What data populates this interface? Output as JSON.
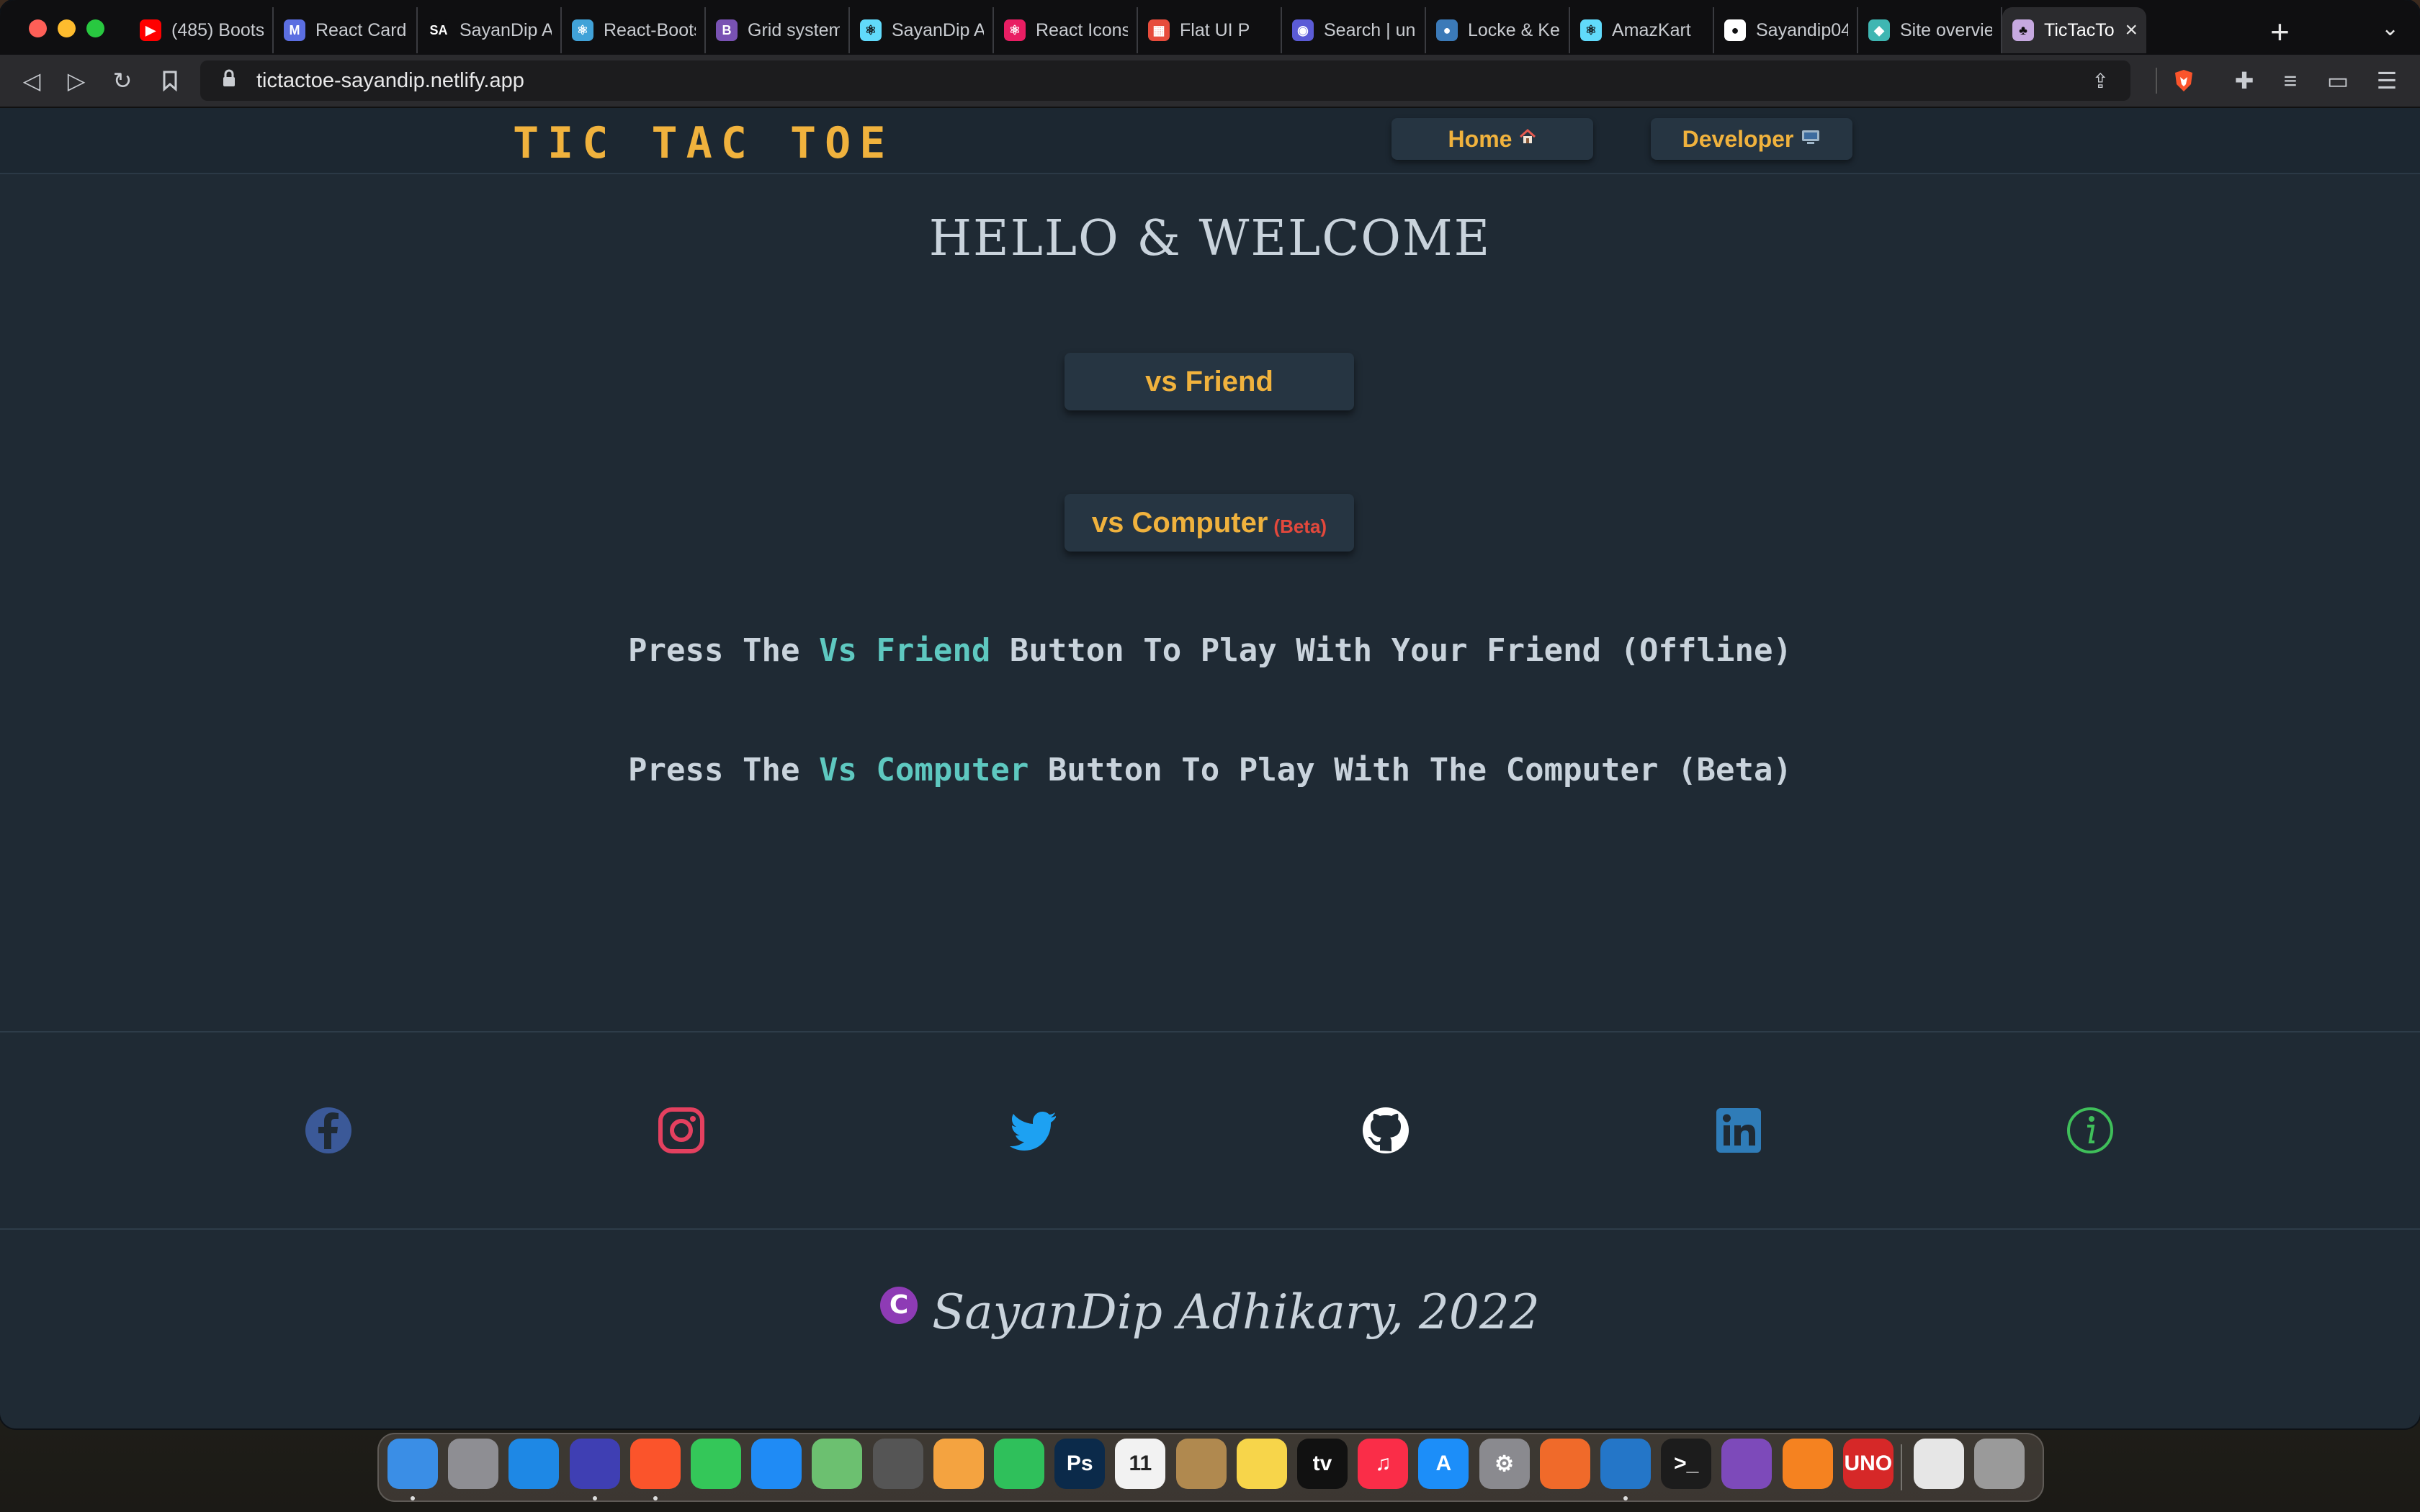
{
  "browser": {
    "tabs": [
      {
        "label": "(485) Boots",
        "favicon": "youtube-icon",
        "color": "#ff0000",
        "glyph": "▶"
      },
      {
        "label": "React Card",
        "favicon": "react-bootstrap-icon",
        "color": "#5b6ee1",
        "glyph": "M"
      },
      {
        "label": "SayanDip Ac",
        "favicon": "sa-icon",
        "color": "#0f0f11",
        "glyph": "SA"
      },
      {
        "label": "React-Boots",
        "favicon": "react-bootstrap-icon",
        "color": "#41a2d8",
        "glyph": "⚛"
      },
      {
        "label": "Grid system",
        "favicon": "bootstrap-icon",
        "color": "#7952b3",
        "glyph": "B"
      },
      {
        "label": "SayanDip Ac",
        "favicon": "react-icon",
        "color": "#61dafb",
        "glyph": "⚛"
      },
      {
        "label": "React Icons",
        "favicon": "react-icon",
        "color": "#e91e63",
        "glyph": "⚛"
      },
      {
        "label": "Flat UI P",
        "favicon": "flat-ui-icon",
        "color": "#e74c3c",
        "glyph": "▦"
      },
      {
        "label": "Search | unD",
        "favicon": "search-icon",
        "color": "#5b5bd6",
        "glyph": "◉"
      },
      {
        "label": "Locke & Key",
        "favicon": "netflix-icon",
        "color": "#3b7ab8",
        "glyph": "●"
      },
      {
        "label": "AmazKart",
        "favicon": "react-icon",
        "color": "#61dafb",
        "glyph": "⚛"
      },
      {
        "label": "Sayandip04",
        "favicon": "github-icon",
        "color": "#ffffff",
        "glyph": "●"
      },
      {
        "label": "Site overvie",
        "favicon": "netlify-icon",
        "color": "#3fb6b2",
        "glyph": "◆"
      },
      {
        "label": "TicTacTo",
        "favicon": "tictactoe-icon",
        "color": "#c6a9e0",
        "glyph": "♣",
        "active": true
      }
    ],
    "url": "tictactoe-sayandip.netlify.app"
  },
  "nav": {
    "brand": "TIC TAC TOE",
    "home_label": "Home",
    "developer_label": "Developer"
  },
  "main": {
    "welcome": "HELLO & WELCOME",
    "vs_friend_label": "vs Friend",
    "vs_computer_label": "vs Computer",
    "beta_label": "(Beta)",
    "instr1": {
      "pre": "Press The ",
      "hl": "Vs Friend",
      "post": " Button To Play With Your Friend (Offline)"
    },
    "instr2": {
      "pre": "Press The ",
      "hl": "Vs Computer",
      "post": " Button To Play With The Computer (Beta)"
    }
  },
  "social": [
    {
      "name": "facebook-icon",
      "color": "#3b5998"
    },
    {
      "name": "instagram-icon",
      "color": "#e1306c"
    },
    {
      "name": "twitter-icon",
      "color": "#1da1f2"
    },
    {
      "name": "github-icon",
      "color": "#ffffff"
    },
    {
      "name": "linkedin-icon",
      "color": "#2f7cb8"
    },
    {
      "name": "info-icon",
      "color": "#3fbf5a"
    }
  ],
  "footer": {
    "copyright_symbol": "C",
    "text": "SayanDip Adhikary, 2022"
  },
  "dock": [
    {
      "name": "finder-icon",
      "color": "#3a8ee6"
    },
    {
      "name": "launchpad-icon",
      "color": "#8e8e93"
    },
    {
      "name": "safari-icon",
      "color": "#1e88e5"
    },
    {
      "name": "firefox-icon",
      "color": "#3f3fb3"
    },
    {
      "name": "brave-icon",
      "color": "#fb542b"
    },
    {
      "name": "messages-icon",
      "color": "#34c759"
    },
    {
      "name": "mail-icon",
      "color": "#1f8bf5"
    },
    {
      "name": "maps-icon",
      "color": "#6cc070"
    },
    {
      "name": "calculator-icon",
      "color": "#555555"
    },
    {
      "name": "photos-icon",
      "color": "#f4a340"
    },
    {
      "name": "facetime-icon",
      "color": "#2fc05b"
    },
    {
      "name": "photoshop-icon",
      "color": "#0b2a4a",
      "glyph": "Ps"
    },
    {
      "name": "calendar-icon",
      "color": "#f2f2f2",
      "glyph": "11"
    },
    {
      "name": "contacts-icon",
      "color": "#b0894f"
    },
    {
      "name": "notes-icon",
      "color": "#f7d54a"
    },
    {
      "name": "apple-tv-icon",
      "color": "#111111",
      "glyph": "tv"
    },
    {
      "name": "music-icon",
      "color": "#fa2d48",
      "glyph": "♫"
    },
    {
      "name": "app-store-icon",
      "color": "#1c8ef9",
      "glyph": "A"
    },
    {
      "name": "system-preferences-icon",
      "color": "#8a8a8f",
      "glyph": "⚙"
    },
    {
      "name": "pencil-app-icon",
      "color": "#f06a2a"
    },
    {
      "name": "vscode-icon",
      "color": "#2476c8"
    },
    {
      "name": "terminal-icon",
      "color": "#1c1c1c",
      "glyph": ">_"
    },
    {
      "name": "github-desktop-icon",
      "color": "#7d4aba"
    },
    {
      "name": "vlc-icon",
      "color": "#f58220"
    },
    {
      "name": "uno-icon",
      "color": "#d62828",
      "glyph": "UNO"
    },
    {
      "name": "document-icon",
      "color": "#e6e6e6"
    },
    {
      "name": "trash-icon",
      "color": "#9a9a9a"
    }
  ]
}
